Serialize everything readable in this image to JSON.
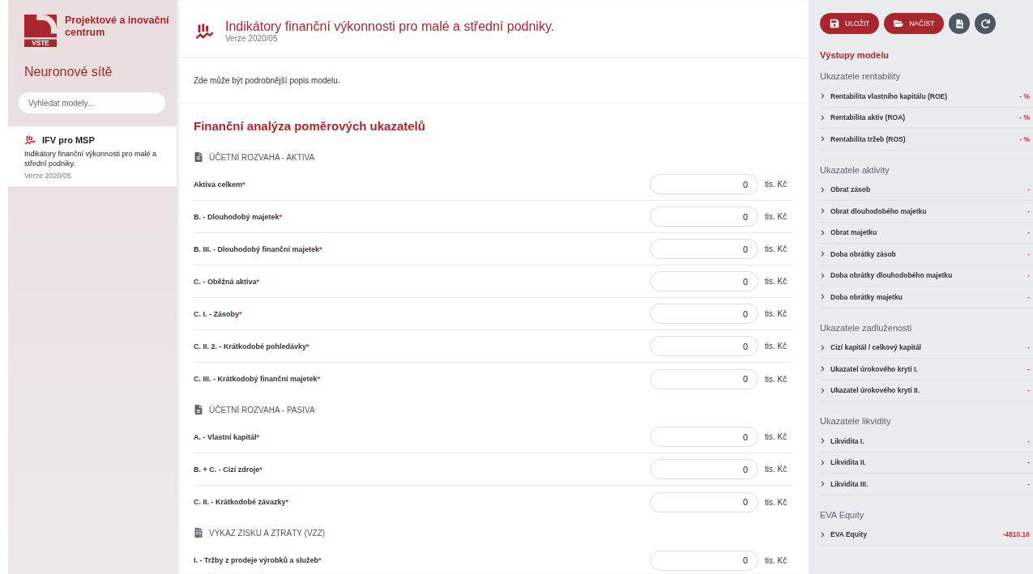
{
  "sidebar": {
    "logo_text": "Projektové a inovační centrum",
    "logo_caption": "VŠTE",
    "title": "Neuronové sítě",
    "search": {
      "placeholder": "Vyhledat modely..."
    },
    "models": [
      {
        "name": "IFV pro MSP",
        "description": "Indikátory finanční výkonnosti pro malé a střední podniky.",
        "version": "Verze 2020/05",
        "selected": true
      }
    ]
  },
  "header": {
    "title": "Indikátory finanční výkonnosti pro malé a střední podniky.",
    "version": "Verze 2020/05"
  },
  "description": "Zde může být podrobnější popis modelu.",
  "form": {
    "title": "Finanční analýza poměrových ukazatelů",
    "sections": [
      {
        "title": "ÚČETNÍ ROZVAHA - AKTIVA",
        "fields": [
          {
            "label": "Aktiva celkem",
            "mark": "*",
            "value": "0",
            "unit": "tis. Kč"
          },
          {
            "label": "B. - Dlouhodobý majetek",
            "mark": "*",
            "value": "0",
            "unit": "tis. Kč"
          },
          {
            "label": "B. III. - Dlouhodobý finanční majetek",
            "mark": "*",
            "value": "0",
            "unit": "tis. Kč"
          },
          {
            "label": "C. - Oběžná aktiva",
            "mark": "*",
            "value": "0",
            "unit": "tis. Kč"
          },
          {
            "label": "C. I. - Zásoby",
            "mark": "*",
            "value": "0",
            "unit": "tis. Kč"
          },
          {
            "label": "C. II. 2. - Krátkodobé pohledávky",
            "mark": "*",
            "value": "0",
            "unit": "tis. Kč"
          },
          {
            "label": "C. III. - Krátkodobý finanční majetek",
            "mark": "*",
            "value": "0",
            "unit": "tis. Kč"
          }
        ]
      },
      {
        "title": "ÚČETNÍ ROZVAHA - PASIVA",
        "fields": [
          {
            "label": "A. - Vlastní kapitál",
            "mark": "*",
            "value": "0",
            "unit": "tis. Kč"
          },
          {
            "label": "B. + C. - Cizí zdroje",
            "mark": "*",
            "value": "0",
            "unit": "tis. Kč"
          },
          {
            "label": "C. II. - Krátkodobé závazky",
            "mark": "*",
            "value": "0",
            "unit": "tis. Kč"
          }
        ]
      },
      {
        "title": "VÝKAZ ZISKU A ZTRÁTY (VZZ)",
        "fields": [
          {
            "label": "I. - Tržby z prodeje výrobků a služeb",
            "mark": "*",
            "value": "0",
            "unit": "tis. Kč"
          }
        ]
      }
    ]
  },
  "toolbar": {
    "buttons": [
      {
        "label": "ULOŽIT",
        "kind": "primary"
      },
      {
        "label": "NAČÍST",
        "kind": "primary"
      },
      {
        "kind": "round"
      },
      {
        "kind": "round"
      }
    ]
  },
  "outputs": {
    "title": "Výstupy modelu",
    "groups": [
      {
        "title": "Ukazatele rentability",
        "items": [
          {
            "label": "Rentabilita vlastního kapitálu (ROE)",
            "value": "- %"
          },
          {
            "label": "Rentabilita aktiv (ROA)",
            "value": "- %"
          },
          {
            "label": "Rentabilita tržeb (ROS)",
            "value": "- %"
          }
        ]
      },
      {
        "title": "Ukazatele aktivity",
        "items": [
          {
            "label": "Obrat zásob",
            "value": "-"
          },
          {
            "label": "Obrat dlouhodobého majetku",
            "value": "-"
          },
          {
            "label": "Obrat majetku",
            "value": "-"
          },
          {
            "label": "Doba obrátky zásob",
            "value": "-"
          },
          {
            "label": "Doba obrátky dlouhodobého majetku",
            "value": "-"
          },
          {
            "label": "Doba obrátky majetku",
            "value": "-"
          }
        ]
      },
      {
        "title": "Ukazatele zadluženosti",
        "items": [
          {
            "label": "Cizí kapitál / celkový kapitál",
            "value": "-"
          },
          {
            "label": "Ukazatel úrokového krytí I.",
            "value": "-"
          },
          {
            "label": "Ukazatel úrokového krytí II.",
            "value": "-"
          }
        ]
      },
      {
        "title": "Ukazatele likvidity",
        "items": [
          {
            "label": "Likvidita I.",
            "value": "-"
          },
          {
            "label": "Likvidita II.",
            "value": "-"
          },
          {
            "label": "Likvidita III.",
            "value": "-"
          }
        ]
      },
      {
        "title": "EVA Equity",
        "items": [
          {
            "label": "EVA Equity",
            "value": "-4810.16"
          }
        ]
      }
    ]
  }
}
